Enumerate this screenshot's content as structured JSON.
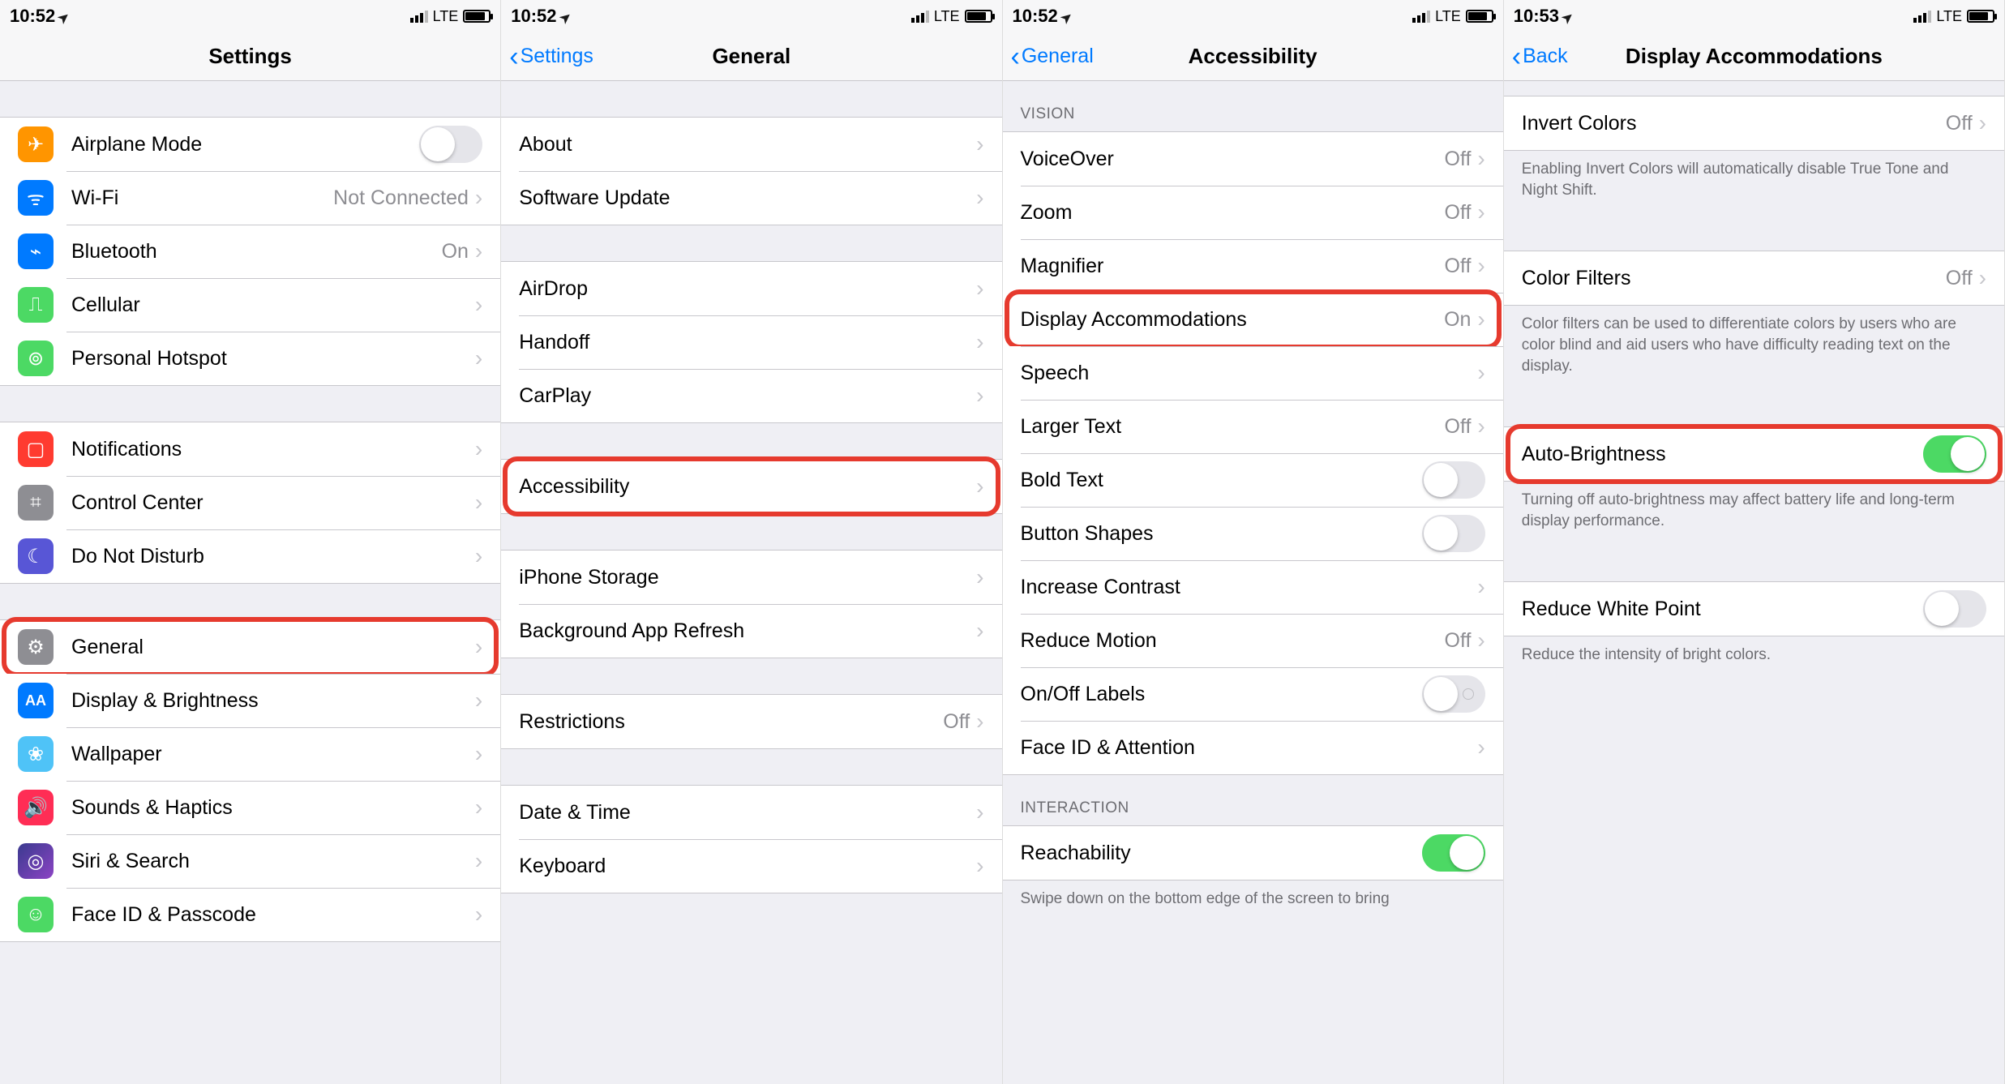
{
  "screens": [
    {
      "time": "10:52",
      "network": "LTE",
      "title": "Settings",
      "back": null,
      "groups": [
        {
          "rows": [
            {
              "icon": "airplane",
              "label": "Airplane Mode",
              "accessory": "toggle",
              "toggleOn": false
            },
            {
              "icon": "wifi",
              "label": "Wi-Fi",
              "detail": "Not Connected",
              "accessory": "chevron"
            },
            {
              "icon": "bluetooth",
              "label": "Bluetooth",
              "detail": "On",
              "accessory": "chevron"
            },
            {
              "icon": "cellular",
              "label": "Cellular",
              "accessory": "chevron"
            },
            {
              "icon": "hotspot",
              "label": "Personal Hotspot",
              "accessory": "chevron"
            }
          ]
        },
        {
          "rows": [
            {
              "icon": "notif",
              "label": "Notifications",
              "accessory": "chevron"
            },
            {
              "icon": "control",
              "label": "Control Center",
              "accessory": "chevron"
            },
            {
              "icon": "dnd",
              "label": "Do Not Disturb",
              "accessory": "chevron"
            }
          ]
        },
        {
          "rows": [
            {
              "icon": "general",
              "label": "General",
              "accessory": "chevron",
              "highlighted": true
            },
            {
              "icon": "display",
              "label": "Display & Brightness",
              "accessory": "chevron"
            },
            {
              "icon": "wallpaper",
              "label": "Wallpaper",
              "accessory": "chevron"
            },
            {
              "icon": "sounds",
              "label": "Sounds & Haptics",
              "accessory": "chevron"
            },
            {
              "icon": "siri",
              "label": "Siri & Search",
              "accessory": "chevron"
            },
            {
              "icon": "faceid",
              "label": "Face ID & Passcode",
              "accessory": "chevron"
            }
          ]
        }
      ]
    },
    {
      "time": "10:52",
      "network": "LTE",
      "title": "General",
      "back": "Settings",
      "groups": [
        {
          "rows": [
            {
              "label": "About",
              "accessory": "chevron"
            },
            {
              "label": "Software Update",
              "accessory": "chevron"
            }
          ]
        },
        {
          "rows": [
            {
              "label": "AirDrop",
              "accessory": "chevron"
            },
            {
              "label": "Handoff",
              "accessory": "chevron"
            },
            {
              "label": "CarPlay",
              "accessory": "chevron"
            }
          ]
        },
        {
          "rows": [
            {
              "label": "Accessibility",
              "accessory": "chevron",
              "highlighted": true
            }
          ]
        },
        {
          "rows": [
            {
              "label": "iPhone Storage",
              "accessory": "chevron"
            },
            {
              "label": "Background App Refresh",
              "accessory": "chevron"
            }
          ]
        },
        {
          "rows": [
            {
              "label": "Restrictions",
              "detail": "Off",
              "accessory": "chevron"
            }
          ]
        },
        {
          "rows": [
            {
              "label": "Date & Time",
              "accessory": "chevron"
            },
            {
              "label": "Keyboard",
              "accessory": "chevron"
            }
          ]
        }
      ]
    },
    {
      "time": "10:52",
      "network": "LTE",
      "title": "Accessibility",
      "back": "General",
      "groups": [
        {
          "header": "VISION",
          "rows": [
            {
              "label": "VoiceOver",
              "detail": "Off",
              "accessory": "chevron"
            },
            {
              "label": "Zoom",
              "detail": "Off",
              "accessory": "chevron"
            },
            {
              "label": "Magnifier",
              "detail": "Off",
              "accessory": "chevron"
            },
            {
              "label": "Display Accommodations",
              "detail": "On",
              "accessory": "chevron",
              "highlighted": true
            },
            {
              "label": "Speech",
              "accessory": "chevron"
            },
            {
              "label": "Larger Text",
              "detail": "Off",
              "accessory": "chevron"
            },
            {
              "label": "Bold Text",
              "accessory": "toggle",
              "toggleOn": false
            },
            {
              "label": "Button Shapes",
              "accessory": "toggle",
              "toggleOn": false
            },
            {
              "label": "Increase Contrast",
              "accessory": "chevron"
            },
            {
              "label": "Reduce Motion",
              "detail": "Off",
              "accessory": "chevron"
            },
            {
              "label": "On/Off Labels",
              "accessory": "toggle",
              "toggleOn": false,
              "outline": true
            },
            {
              "label": "Face ID & Attention",
              "accessory": "chevron"
            }
          ]
        },
        {
          "header": "INTERACTION",
          "footer": "Swipe down on the bottom edge of the screen to bring",
          "rows": [
            {
              "label": "Reachability",
              "accessory": "toggle",
              "toggleOn": true
            }
          ]
        }
      ]
    },
    {
      "time": "10:53",
      "network": "LTE",
      "title": "Display Accommodations",
      "back": "Back",
      "groups": [
        {
          "prespacer": true,
          "footer": "Enabling Invert Colors will automatically disable True Tone and Night Shift.",
          "rows": [
            {
              "label": "Invert Colors",
              "detail": "Off",
              "accessory": "chevron"
            }
          ]
        },
        {
          "footer": "Color filters can be used to differentiate colors by users who are color blind and aid users who have difficulty reading text on the display.",
          "rows": [
            {
              "label": "Color Filters",
              "detail": "Off",
              "accessory": "chevron"
            }
          ]
        },
        {
          "footer": "Turning off auto-brightness may affect battery life and long-term display performance.",
          "rows": [
            {
              "label": "Auto-Brightness",
              "accessory": "toggle",
              "toggleOn": true,
              "highlighted": true
            }
          ]
        },
        {
          "footer": "Reduce the intensity of bright colors.",
          "rows": [
            {
              "label": "Reduce White Point",
              "accessory": "toggle",
              "toggleOn": false
            }
          ]
        }
      ]
    }
  ],
  "iconGlyphs": {
    "airplane": "✈",
    "wifi": "ᯤ",
    "bluetooth": "⌁",
    "cellular": "⎍",
    "hotspot": "⊚",
    "notif": "▢",
    "control": "⌗",
    "dnd": "☾",
    "general": "⚙",
    "display": "AA",
    "wallpaper": "❀",
    "sounds": "🔊",
    "siri": "◎",
    "faceid": "☺"
  }
}
